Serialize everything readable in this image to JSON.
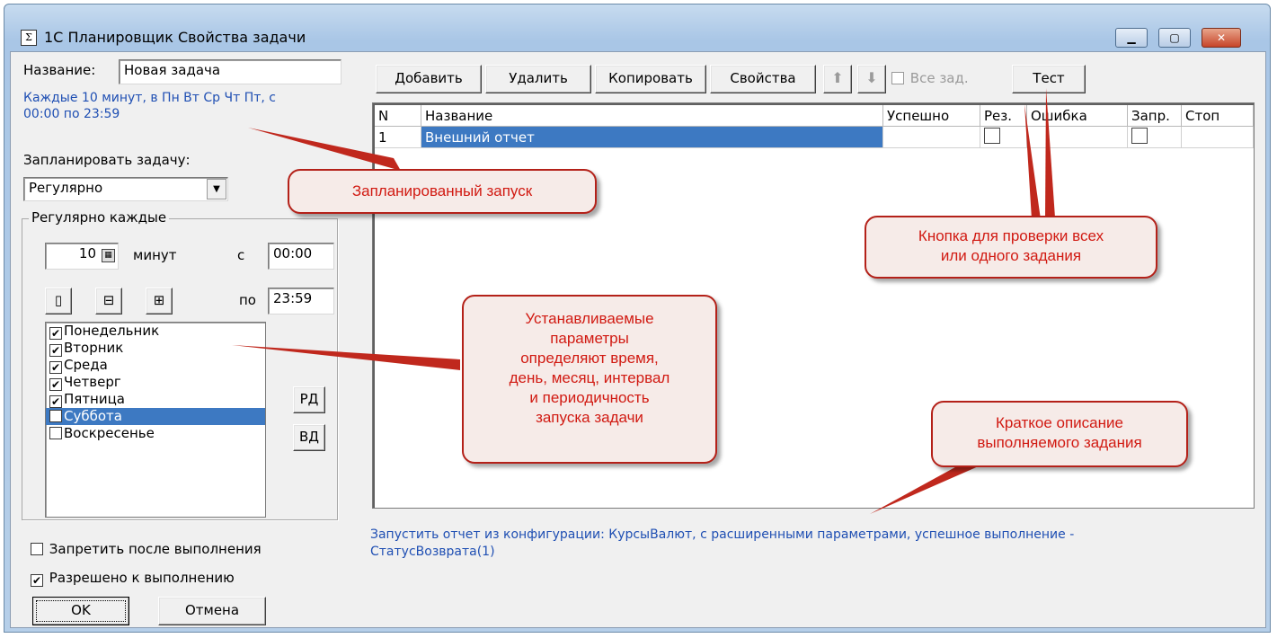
{
  "window": {
    "title": "1С Планировщик Свойства задачи",
    "icon_glyph": "Σ",
    "controls": {
      "minimize": "▁",
      "maximize": "▢",
      "close": "✕"
    }
  },
  "left": {
    "name_label": "Название:",
    "name_value": "Новая задача",
    "schedule_summary_line1": "Каждые 10 минут, в Пн Вт Ср Чт Пт, с",
    "schedule_summary_line2": "00:00 по 23:59",
    "schedule_label": "Запланировать задачу:",
    "schedule_mode": "Регулярно",
    "regular_group_title": "Регулярно каждые",
    "interval_value": "10",
    "interval_unit": "минут",
    "from_label": "с",
    "from_value": "00:00",
    "to_label": "по",
    "to_value": "23:59",
    "period_icons": [
      "bracket-day-icon",
      "bracket-icon",
      "grid-icon"
    ],
    "days": [
      {
        "label": "Понедельник",
        "checked": true
      },
      {
        "label": "Вторник",
        "checked": true
      },
      {
        "label": "Среда",
        "checked": true
      },
      {
        "label": "Четверг",
        "checked": true
      },
      {
        "label": "Пятница",
        "checked": true
      },
      {
        "label": "Суббота",
        "checked": false,
        "selected": true
      },
      {
        "label": "Воскресенье",
        "checked": false
      }
    ],
    "workdays_btn": "РД",
    "weekend_btn": "ВД",
    "forbid_after_run": "Запретить после выполнения",
    "forbid_after_run_checked": false,
    "allowed_to_run": "Разрешено к выполнению",
    "allowed_to_run_checked": true,
    "ok_btn": "OK",
    "cancel_btn": "Отмена"
  },
  "toolbar": {
    "add": "Добавить",
    "delete": "Удалить",
    "copy": "Копировать",
    "properties": "Свойства",
    "up_icon": "arrow-up-icon",
    "down_icon": "arrow-down-icon",
    "all_tasks": "Все зад.",
    "test": "Тест"
  },
  "table": {
    "columns": [
      "N",
      "Название",
      "Успешно",
      "Рез.",
      "Ошибка",
      "Запр.",
      "Стоп"
    ],
    "rows": [
      {
        "n": "1",
        "name": "Внешний отчет",
        "success": "",
        "res": false,
        "error": "",
        "forbid": false,
        "stop": ""
      }
    ]
  },
  "description_line1": "Запустить отчет из конфигурации: КурсыВалют, с расширенными параметрами, успешное выполнение -",
  "description_line2": "СтатусВозврата(1)",
  "callouts": {
    "scheduled": "Запланированный запуск",
    "test_btn_line1": "Кнопка для проверки всех",
    "test_btn_line2": "или одного задания",
    "params_line1": "Устанавливаемые",
    "params_line2": "параметры",
    "params_line3": "определяют время,",
    "params_line4": "день, месяц, интервал",
    "params_line5": "и периодичность",
    "params_line6": "запуска задачи",
    "desc_line1": "Краткое описание",
    "desc_line2": "выполняемого задания"
  },
  "colors": {
    "callout_red": "#d11a12",
    "selection_blue": "#3d79c2",
    "summary_blue": "#1f4fb3"
  }
}
